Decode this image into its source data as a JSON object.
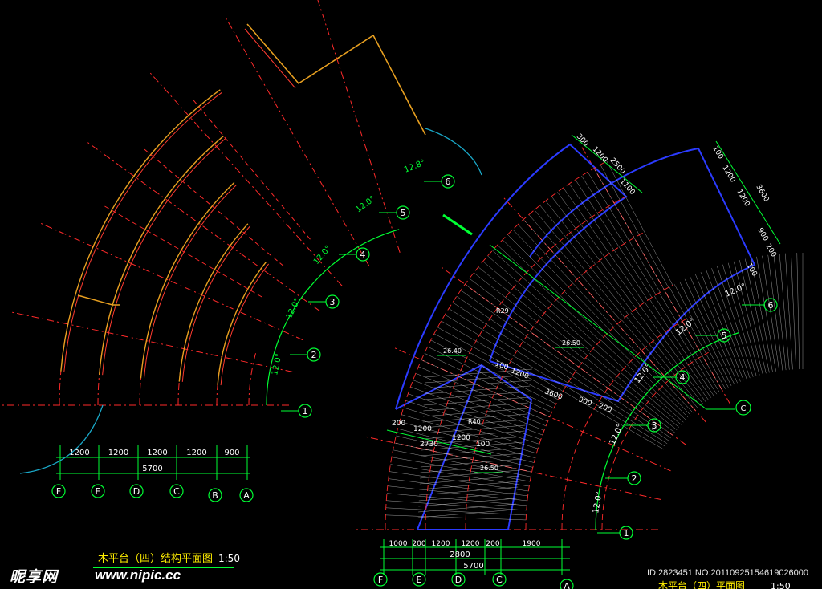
{
  "left_plan": {
    "title": "木平台（四）结构平面图",
    "scale": "1:50",
    "axis_numbers": [
      "1",
      "2",
      "3",
      "4",
      "5",
      "6"
    ],
    "axis_letters": [
      "F",
      "E",
      "D",
      "C",
      "B",
      "A"
    ],
    "angles": [
      "12.0°",
      "12.0°",
      "12.0°",
      "12.0°",
      "12.8°"
    ],
    "dims_top": [
      "1200",
      "1200",
      "1200",
      "1200",
      "900"
    ],
    "dim_total": "5700"
  },
  "right_plan": {
    "title": "木平台（四）平面图",
    "scale": "1:50",
    "axis_numbers": [
      "1",
      "2",
      "3",
      "4",
      "5",
      "6"
    ],
    "axis_letters": [
      "F",
      "E",
      "D",
      "C",
      "A"
    ],
    "angles": [
      "12.0°",
      "12.0°",
      "12.0°",
      "12.0°",
      "12.0°"
    ],
    "dims_bottom_1": [
      "1000",
      "200",
      "1200",
      "1200",
      "200",
      "1900"
    ],
    "dim_2800": "2800",
    "dim_5700": "5700",
    "dims_lower_leg": [
      "200",
      "1200",
      "1200",
      "100"
    ],
    "dim_2730": "2730",
    "dims_step": [
      "100",
      "1200",
      "3600",
      "900",
      "200"
    ],
    "dims_top_left": [
      "300",
      "1200",
      "2500",
      "1100"
    ],
    "dims_top_right": [
      "100",
      "1200",
      "1200",
      "3600",
      "900",
      "200",
      "100"
    ],
    "radius_labels": [
      "R29",
      "R40"
    ],
    "slope_labels": [
      "26.40",
      "26.50",
      "26.50"
    ],
    "detail_mark": "C"
  },
  "watermark": {
    "logo": "昵享网",
    "url": "www.nipic.cc",
    "id": "ID:2823451 NO:20110925154619026000"
  },
  "colors": {
    "background": "#000000",
    "axis": "#ff2a2a",
    "beam": "#e8a020",
    "beam_inner": "#ff3b30",
    "dimension": "#00ff33",
    "outline": "#2b3bff",
    "plank": "#d9d9d9",
    "curve": "#1aa8c8"
  }
}
